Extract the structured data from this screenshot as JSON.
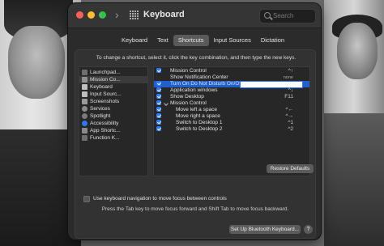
{
  "window": {
    "title": "Keyboard"
  },
  "search": {
    "placeholder": "Search"
  },
  "tabs": [
    {
      "label": "Keyboard",
      "active": false
    },
    {
      "label": "Text",
      "active": false
    },
    {
      "label": "Shortcuts",
      "active": true
    },
    {
      "label": "Input Sources",
      "active": false
    },
    {
      "label": "Dictation",
      "active": false
    }
  ],
  "instructions": "To change a shortcut, select it, click the key combination, and then type the new keys.",
  "categories": [
    {
      "label": "Launchpad...",
      "icon": "launchpad-icon",
      "selected": false
    },
    {
      "label": "Mission Co...",
      "icon": "mission-control-icon",
      "selected": true
    },
    {
      "label": "Keyboard",
      "icon": "keyboard-icon",
      "selected": false
    },
    {
      "label": "Input Sourc...",
      "icon": "input-sources-icon",
      "selected": false
    },
    {
      "label": "Screenshots",
      "icon": "screenshots-icon",
      "selected": false
    },
    {
      "label": "Services",
      "icon": "services-icon",
      "selected": false
    },
    {
      "label": "Spotlight",
      "icon": "spotlight-icon",
      "selected": false
    },
    {
      "label": "Accessibility",
      "icon": "accessibility-icon",
      "selected": false
    },
    {
      "label": "App Shortc...",
      "icon": "app-shortcuts-icon",
      "selected": false
    },
    {
      "label": "Function K...",
      "icon": "function-keys-icon",
      "selected": false
    }
  ],
  "shortcuts": [
    {
      "label": "Mission Control",
      "key": "^↑",
      "checked": true,
      "type": "item"
    },
    {
      "label": "Show Notification Center",
      "key": "none",
      "checked": false,
      "type": "item"
    },
    {
      "label": "Turn On Do Not Disturb On/Off",
      "key": "",
      "checked": true,
      "type": "editing"
    },
    {
      "label": "Application windows",
      "key": "^↓",
      "checked": true,
      "type": "item"
    },
    {
      "label": "Show Desktop",
      "key": "F11",
      "checked": true,
      "type": "item"
    },
    {
      "label": "Mission Control",
      "key": "",
      "checked": true,
      "type": "group"
    },
    {
      "label": "Move left a space",
      "key": "^←",
      "checked": true,
      "type": "sub"
    },
    {
      "label": "Move right a space",
      "key": "^→",
      "checked": true,
      "type": "sub"
    },
    {
      "label": "Switch to Desktop 1",
      "key": "^1",
      "checked": true,
      "type": "sub"
    },
    {
      "label": "Switch to Desktop 2",
      "key": "^2",
      "checked": true,
      "type": "sub"
    }
  ],
  "buttons": {
    "restore": "Restore Defaults",
    "bluetooth": "Set Up Bluetooth Keyboard...",
    "help": "?"
  },
  "keyboard_nav": {
    "label": "Use keyboard navigation to move focus between controls",
    "hint": "Press the Tab key to move focus forward and Shift Tab to move focus backward."
  }
}
